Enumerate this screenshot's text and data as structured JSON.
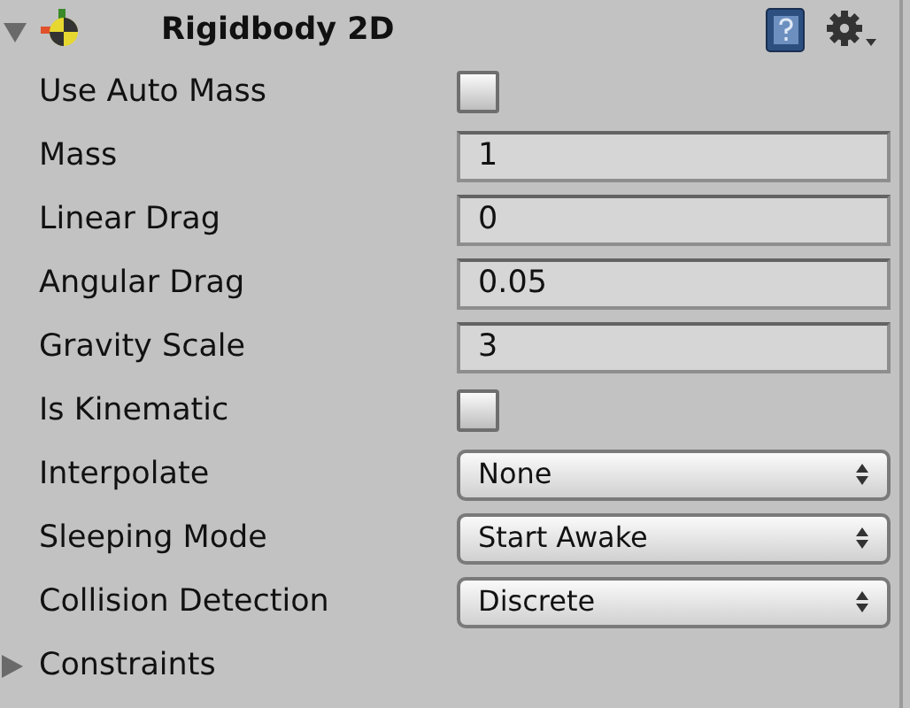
{
  "component": {
    "title": "Rigidbody 2D",
    "expanded": true
  },
  "properties": [
    {
      "kind": "checkbox",
      "label": "Use Auto Mass",
      "checked": false
    },
    {
      "kind": "number",
      "label": "Mass",
      "value": "1"
    },
    {
      "kind": "number",
      "label": "Linear Drag",
      "value": "0"
    },
    {
      "kind": "number",
      "label": "Angular Drag",
      "value": "0.05"
    },
    {
      "kind": "number",
      "label": "Gravity Scale",
      "value": "3"
    },
    {
      "kind": "checkbox",
      "label": "Is Kinematic",
      "checked": false
    },
    {
      "kind": "dropdown",
      "label": "Interpolate",
      "value": "None"
    },
    {
      "kind": "dropdown",
      "label": "Sleeping Mode",
      "value": "Start Awake"
    },
    {
      "kind": "dropdown",
      "label": "Collision Detection",
      "value": "Discrete"
    },
    {
      "kind": "foldout",
      "label": "Constraints",
      "expanded": false
    }
  ]
}
